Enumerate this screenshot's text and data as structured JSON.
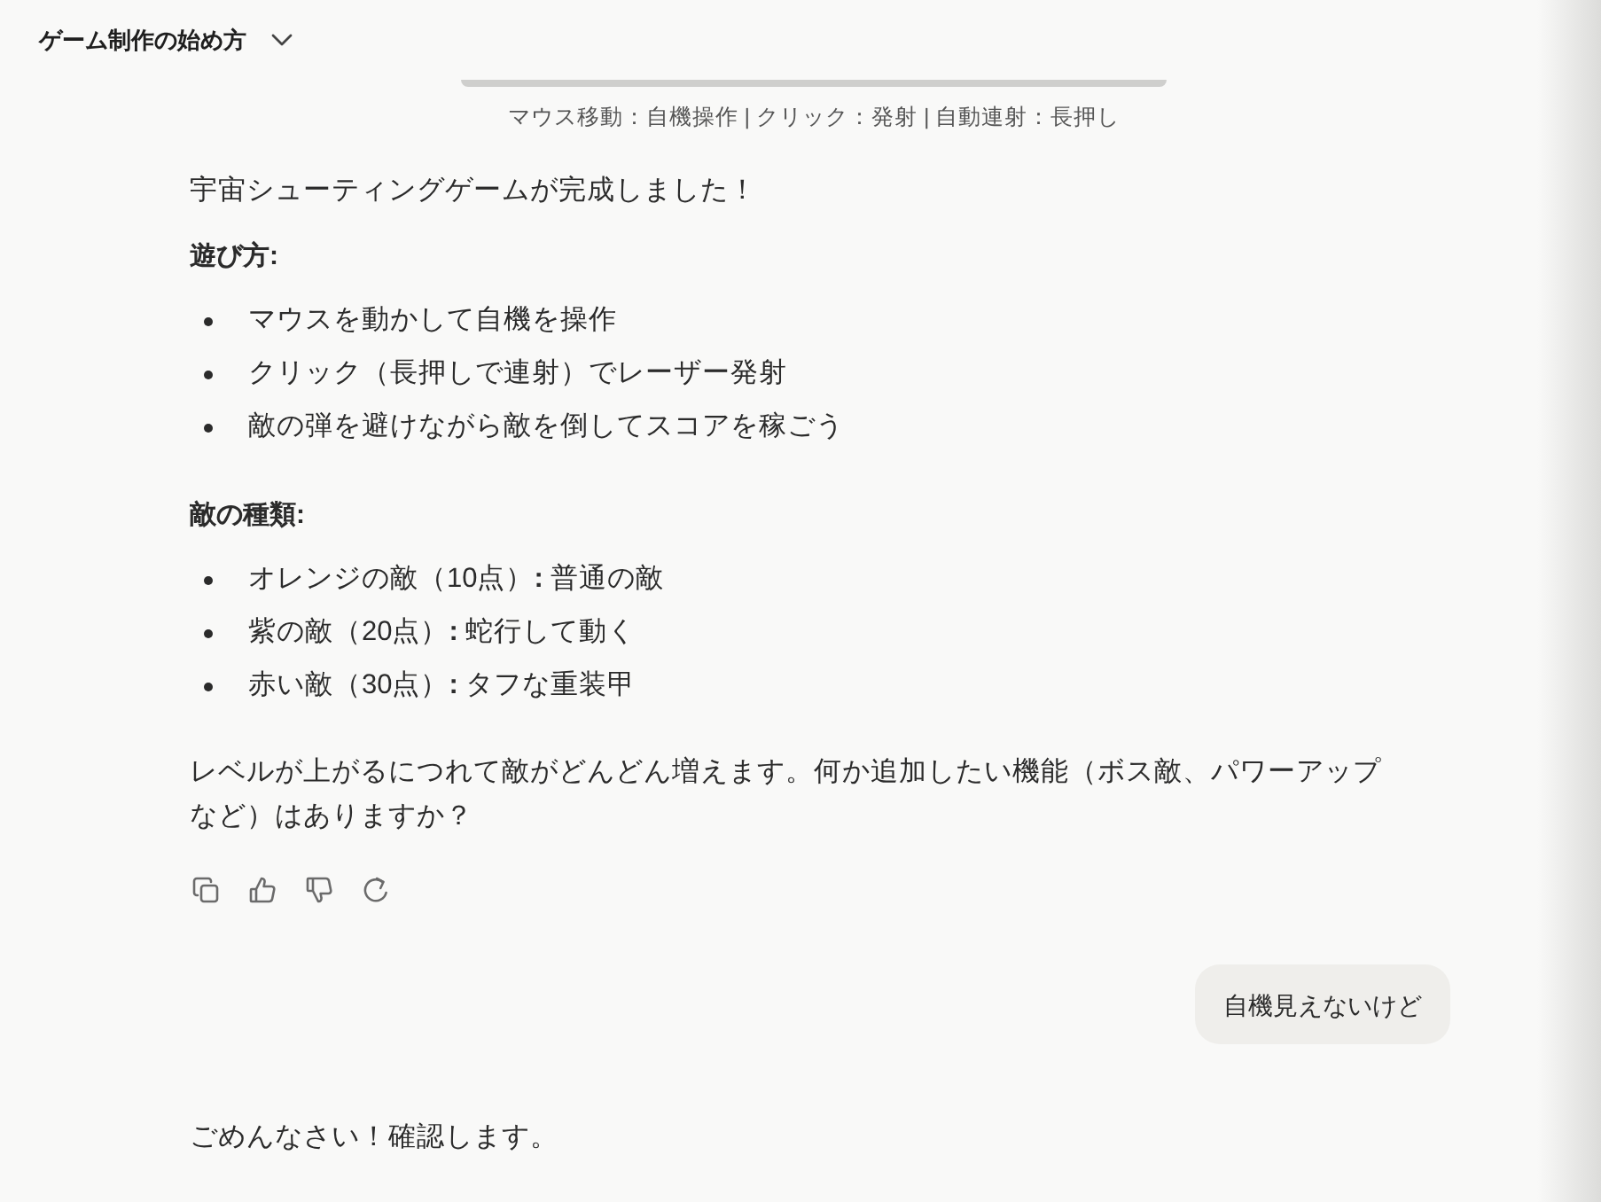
{
  "header": {
    "title": "ゲーム制作の始め方"
  },
  "preview": {
    "caption": "マウス移動：自機操作 | クリック：発射 | 自動連射：長押し"
  },
  "messages": [
    {
      "kind": "assistant",
      "actions_bar": true,
      "blocks": [
        {
          "kind": "paragraph",
          "text": "宇宙シューティングゲームが完成しました！"
        },
        {
          "kind": "heading",
          "text": "遊び方:"
        },
        {
          "kind": "list",
          "items": [
            "マウスを動かして自機を操作",
            "クリック（長押しで連射）でレーザー発射",
            "敵の弾を避けながら敵を倒してスコアを稼ごう"
          ]
        },
        {
          "kind": "heading",
          "text": "敵の種類:"
        },
        {
          "kind": "list",
          "items": [
            "オレンジの敵（10点）**:** 普通の敵",
            "紫の敵（20点）**:** 蛇行して動く",
            "赤い敵（30点）**:** タフな重装甲"
          ]
        },
        {
          "kind": "paragraph",
          "text": "レベルが上がるにつれて敵がどんどん増えます。何か追加したい機能（ボス敵、パワーアップなど）はありますか？"
        }
      ]
    },
    {
      "kind": "user",
      "text": "自機見えないけど"
    },
    {
      "kind": "assistant",
      "blocks": [
        {
          "kind": "paragraph",
          "text": "ごめんなさい！確認します。"
        }
      ]
    }
  ]
}
